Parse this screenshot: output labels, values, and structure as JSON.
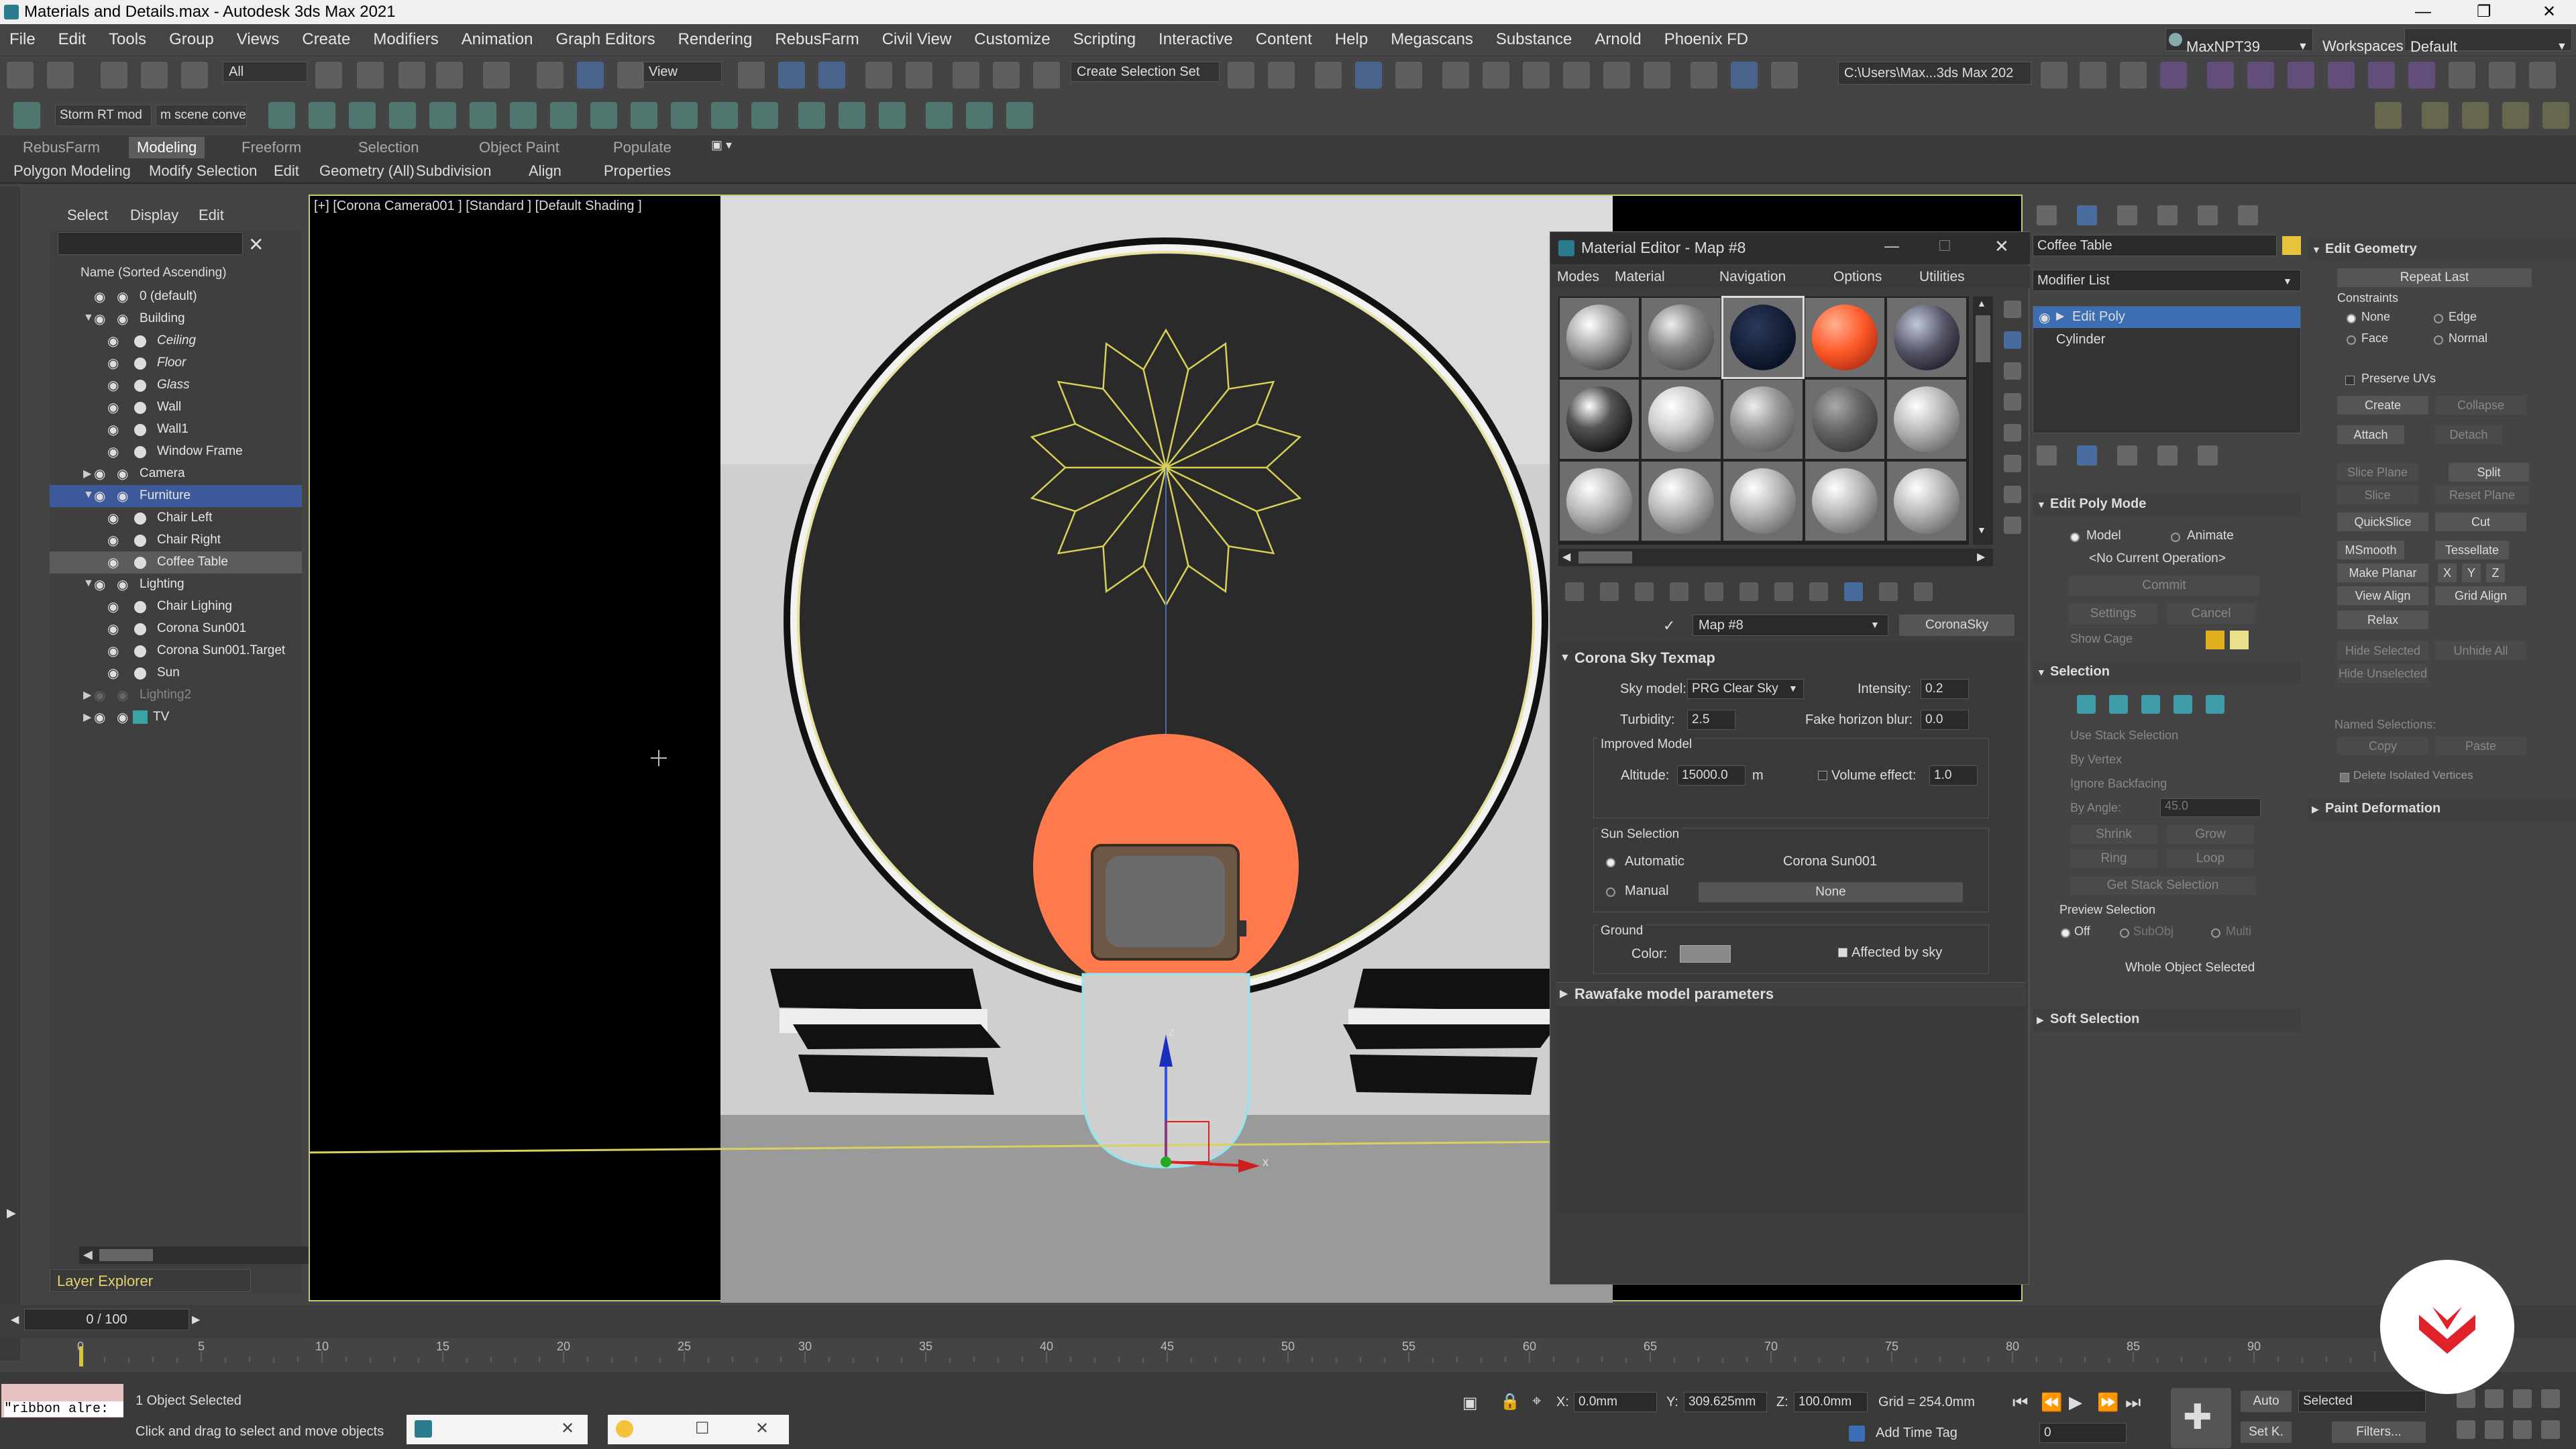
{
  "window": {
    "title": "Materials and Details.max - Autodesk 3ds Max 2021"
  },
  "menu": [
    "File",
    "Edit",
    "Tools",
    "Group",
    "Views",
    "Create",
    "Modifiers",
    "Animation",
    "Graph Editors",
    "Rendering",
    "RebusFarm",
    "Civil View",
    "Customize",
    "Scripting",
    "Interactive",
    "Content",
    "Help",
    "Megascans",
    "Substance",
    "Arnold",
    "Phoenix FD"
  ],
  "user": {
    "name": "MaxNPT39",
    "workspaces_label": "Workspaces:",
    "workspace": "Default"
  },
  "toolbar": {
    "filter": "All",
    "view": "View",
    "selection_set": "Create Selection Set",
    "path": "C:\\Users\\Max...3ds Max 202"
  },
  "toolbar2": {
    "storm": "Storm RT mod",
    "inscene": "m scene conve"
  },
  "ribbon": {
    "tabs": [
      "RebusFarm",
      "Modeling",
      "Freeform",
      "Selection",
      "Object Paint",
      "Populate"
    ],
    "active": "Modeling",
    "sub": [
      "Polygon Modeling",
      "Modify Selection",
      "Edit",
      "Geometry (All)",
      "Subdivision",
      "Align",
      "Properties"
    ]
  },
  "explorer": {
    "tabs": [
      "Select",
      "Display",
      "Edit"
    ],
    "header": "Name (Sorted Ascending)",
    "rows": [
      {
        "label": "0 (default)",
        "indent": 0,
        "type": "layer"
      },
      {
        "label": "Building",
        "indent": 0,
        "type": "layer",
        "open": true
      },
      {
        "label": "Ceiling",
        "indent": 1,
        "type": "obj",
        "italic": true
      },
      {
        "label": "Floor",
        "indent": 1,
        "type": "obj",
        "italic": true
      },
      {
        "label": "Glass",
        "indent": 1,
        "type": "obj",
        "italic": true
      },
      {
        "label": "Wall",
        "indent": 1,
        "type": "obj"
      },
      {
        "label": "Wall1",
        "indent": 1,
        "type": "obj"
      },
      {
        "label": "Window Frame",
        "indent": 1,
        "type": "obj"
      },
      {
        "label": "Camera",
        "indent": 0,
        "type": "layer",
        "closed": true
      },
      {
        "label": "Furniture",
        "indent": 0,
        "type": "layer",
        "open": true,
        "sel": "blue"
      },
      {
        "label": "Chair Left",
        "indent": 1,
        "type": "obj"
      },
      {
        "label": "Chair Right",
        "indent": 1,
        "type": "obj"
      },
      {
        "label": "Coffee Table",
        "indent": 1,
        "type": "obj",
        "sel": "grey"
      },
      {
        "label": "Lighting",
        "indent": 0,
        "type": "layer",
        "open": true
      },
      {
        "label": "Chair Lighing",
        "indent": 1,
        "type": "light"
      },
      {
        "label": "Corona Sun001",
        "indent": 1,
        "type": "light"
      },
      {
        "label": "Corona Sun001.Target",
        "indent": 1,
        "type": "light"
      },
      {
        "label": "Sun",
        "indent": 1,
        "type": "obj"
      },
      {
        "label": "Lighting2",
        "indent": 0,
        "type": "layer",
        "closed": true,
        "dim": true
      },
      {
        "label": "TV",
        "indent": 0,
        "type": "layer",
        "closed": true
      }
    ],
    "footer": "Layer Explorer"
  },
  "viewport": {
    "label": "[+] [Corona Camera001 ] [Standard ] [Default Shading ]"
  },
  "material_editor": {
    "title": "Material Editor - Map #8",
    "menu": [
      "Modes",
      "Material",
      "Navigation",
      "Options",
      "Utilities"
    ],
    "map_name": "Map #8",
    "map_type": "CoronaSky",
    "rollout": "Corona Sky Texmap",
    "sky_model_label": "Sky model:",
    "sky_model": "PRG Clear Sky",
    "intensity_label": "Intensity:",
    "intensity": "0.2",
    "turbidity_label": "Turbidity:",
    "turbidity": "2.5",
    "horizon_label": "Fake horizon blur:",
    "horizon": "0.0",
    "improved_label": "Improved Model",
    "altitude_label": "Altitude:",
    "altitude": "15000.0",
    "altitude_unit": "m",
    "volume_label": "Volume effect:",
    "volume": "1.0",
    "sun_sel_label": "Sun Selection",
    "automatic": "Automatic",
    "sun_name": "Corona Sun001",
    "manual": "Manual",
    "none": "None",
    "ground_label": "Ground",
    "color_label": "Color:",
    "affected": "Affected by sky",
    "rawafake": "Rawafake model parameters"
  },
  "command_panel": {
    "object_name": "Coffee Table",
    "modifier_list": "Modifier List",
    "stack": [
      "Edit Poly",
      "Cylinder"
    ],
    "edit_poly_mode": "Edit Poly Mode",
    "model": "Model",
    "animate": "Animate",
    "no_op": "<No Current Operation>",
    "commit": "Commit",
    "settings": "Settings",
    "cancel": "Cancel",
    "show_cage": "Show Cage",
    "selection": "Selection",
    "use_stack": "Use Stack Selection",
    "by_vertex": "By Vertex",
    "ignore_bf": "Ignore Backfacing",
    "by_angle": "By Angle:",
    "angle": "45.0",
    "shrink": "Shrink",
    "grow": "Grow",
    "ring": "Ring",
    "loop": "Loop",
    "get_stack": "Get Stack Selection",
    "preview": "Preview Selection",
    "off": "Off",
    "subobj": "SubObj",
    "multi": "Multi",
    "whole": "Whole Object Selected",
    "soft": "Soft Selection",
    "edit_geometry": "Edit Geometry",
    "repeat_last": "Repeat Last",
    "constraints": "Constraints",
    "c_none": "None",
    "c_edge": "Edge",
    "c_face": "Face",
    "c_normal": "Normal",
    "preserve": "Preserve UVs",
    "create": "Create",
    "collapse": "Collapse",
    "attach": "Attach",
    "detach": "Detach",
    "slice_plane": "Slice Plane",
    "split": "Split",
    "slice": "Slice",
    "reset_plane": "Reset Plane",
    "quickslice": "QuickSlice",
    "cut": "Cut",
    "msmooth": "MSmooth",
    "tessellate": "Tessellate",
    "make_planar": "Make Planar",
    "x": "X",
    "y": "Y",
    "z": "Z",
    "view_align": "View Align",
    "grid_align": "Grid Align",
    "relax": "Relax",
    "hide_sel": "Hide Selected",
    "unhide_all": "Unhide All",
    "hide_unsel": "Hide Unselected",
    "named_sel": "Named Selections:",
    "copy": "Copy",
    "paste": "Paste",
    "delete_iso": "Delete Isolated Vertices",
    "paint_def": "Paint Deformation"
  },
  "timeline": {
    "frame": "0 / 100",
    "ticks": [
      "0",
      "5",
      "10",
      "15",
      "20",
      "25",
      "30",
      "35",
      "40",
      "45",
      "50",
      "55",
      "60",
      "65",
      "70",
      "75",
      "80",
      "85",
      "90"
    ]
  },
  "status": {
    "selected": "1 Object Selected",
    "hint": "Click and drag to select and move objects",
    "maxscript": "\"ribbon alre:",
    "x": "0.0mm",
    "y": "309.625mm",
    "z": "100.0mm",
    "grid": "Grid = 254.0mm",
    "add_time_tag": "Add Time Tag",
    "auto": "Auto",
    "set_k": "Set K.",
    "selected_dd": "Selected",
    "filters": "Filters...",
    "frame_field": "0"
  }
}
